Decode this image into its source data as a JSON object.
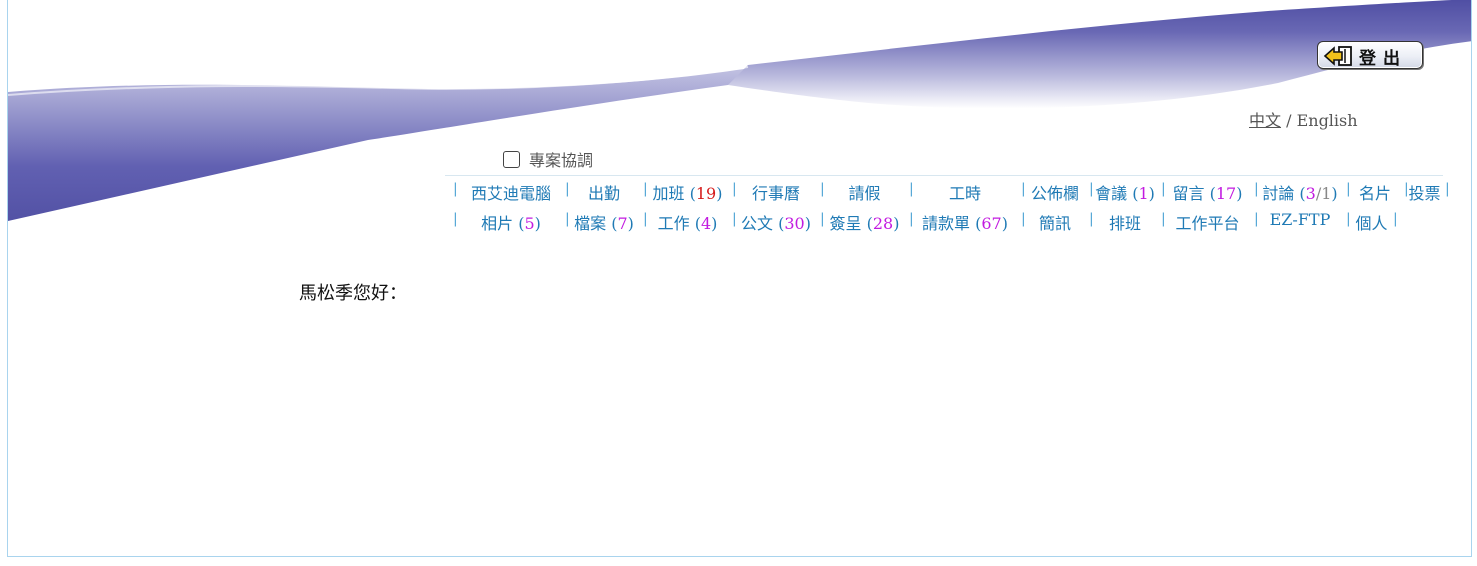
{
  "header": {
    "logout_label": "登出",
    "lang_zh": "中文",
    "lang_sep": " / ",
    "lang_en": "English"
  },
  "project_toggle": {
    "label": "專案協調",
    "checked": false
  },
  "nav": {
    "row1": [
      {
        "label": "西艾迪電腦",
        "count": null
      },
      {
        "label": "出勤",
        "count": null
      },
      {
        "label": "加班",
        "count": "19",
        "count_color": "red"
      },
      {
        "label": "行事曆",
        "count": null
      },
      {
        "label": "請假",
        "count": null
      },
      {
        "label": "工時",
        "count": null
      },
      {
        "label": "公佈欄",
        "count": null
      },
      {
        "label": "會議",
        "count": "1"
      },
      {
        "label": "留言",
        "count": "17"
      },
      {
        "label": "討論",
        "count": "3",
        "count2": "1"
      },
      {
        "label": "名片",
        "count": null
      },
      {
        "label": "投票",
        "count": null
      }
    ],
    "row2": [
      {
        "label": "相片",
        "count": "5"
      },
      {
        "label": "檔案",
        "count": "7"
      },
      {
        "label": "工作",
        "count": "4"
      },
      {
        "label": "公文",
        "count": "30"
      },
      {
        "label": "簽呈",
        "count": "28"
      },
      {
        "label": "請款單",
        "count": "67"
      },
      {
        "label": "簡訊",
        "count": null
      },
      {
        "label": "排班",
        "count": null
      },
      {
        "label": "工作平台",
        "count": null
      },
      {
        "label": "EZ-FTP",
        "count": null
      },
      {
        "label": "個人",
        "count": null
      }
    ]
  },
  "greeting": "馬松季您好：",
  "colors": {
    "link": "#1f7ab5",
    "count": "#c21be0",
    "count_alert": "#d61a1a",
    "wave": "#5b5aa8",
    "border": "#a9d4ee"
  }
}
